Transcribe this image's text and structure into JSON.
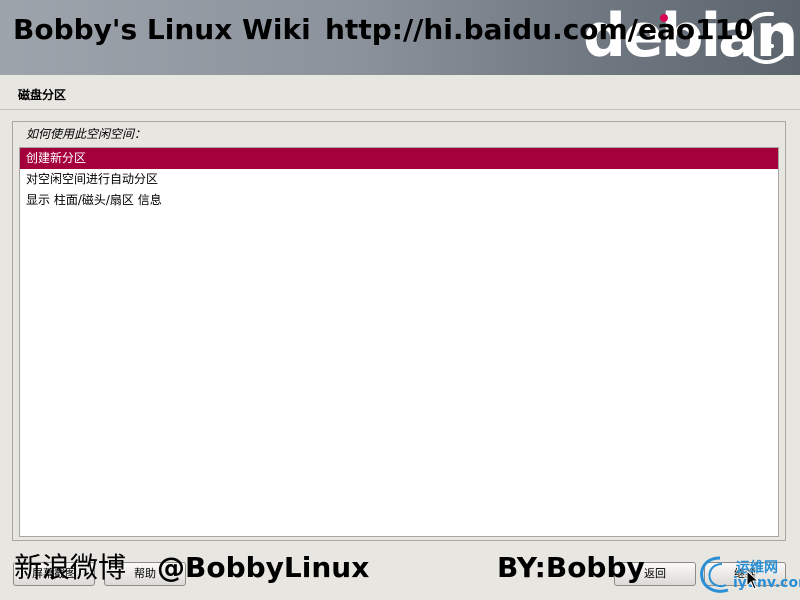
{
  "banner": {
    "logo_text": "debian",
    "watermark_title": "Bobby's Linux Wiki",
    "watermark_url": "http://hi.baidu.com/eao110"
  },
  "step": {
    "title": "磁盘分区",
    "question": "如何使用此空闲空间："
  },
  "options": [
    {
      "label": "创建新分区",
      "selected": true
    },
    {
      "label": "对空闲空间进行自动分区",
      "selected": false
    },
    {
      "label": "显示 柱面/磁头/扇区 信息",
      "selected": false
    }
  ],
  "buttons": {
    "screenshot": "屏幕截图",
    "help": "帮助",
    "back": "返回",
    "continue": "继续"
  },
  "watermarks": {
    "weibo": "新浪微博",
    "handle": "@BobbyLinux",
    "by": "BY:Bobby",
    "site_cn": "运维网",
    "site_en": "iyunv.com"
  },
  "colors": {
    "selection": "#a5003b",
    "debian_red": "#d70751",
    "iyunv_blue": "#2a8fd4"
  }
}
